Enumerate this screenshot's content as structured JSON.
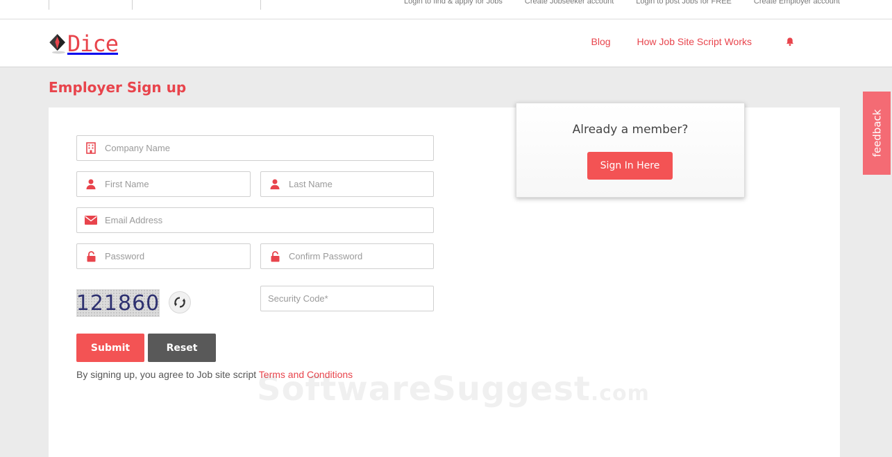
{
  "topbar": {
    "links": [
      "Login to find & apply for Jobs",
      "Create Jobseeker account",
      "Login to post Jobs for FREE",
      "Create Employer account"
    ]
  },
  "header": {
    "logo_text": "Dice",
    "nav": [
      "Blog",
      "How Job Site Script Works"
    ]
  },
  "page_title": "Employer Sign up",
  "form": {
    "company_placeholder": "Company Name",
    "first_name_placeholder": "First Name",
    "last_name_placeholder": "Last Name",
    "email_placeholder": "Email Address",
    "password_placeholder": "Password",
    "confirm_password_placeholder": "Confirm Password",
    "security_code_placeholder": "Security Code*",
    "captcha_code": "121860",
    "submit_label": "Submit",
    "reset_label": "Reset",
    "terms_prefix": "By signing up, you agree to Job site script ",
    "terms_link": "Terms and Conditions"
  },
  "member_box": {
    "heading": "Already a member?",
    "signin_label": "Sign In Here"
  },
  "feedback_label": "feedback",
  "watermark": {
    "main": "SoftwareSuggest",
    "suffix": ".com"
  },
  "colors": {
    "accent": "#e8444c",
    "button_red": "#f35354",
    "button_dark": "#595959",
    "feedback": "#f46b74"
  }
}
